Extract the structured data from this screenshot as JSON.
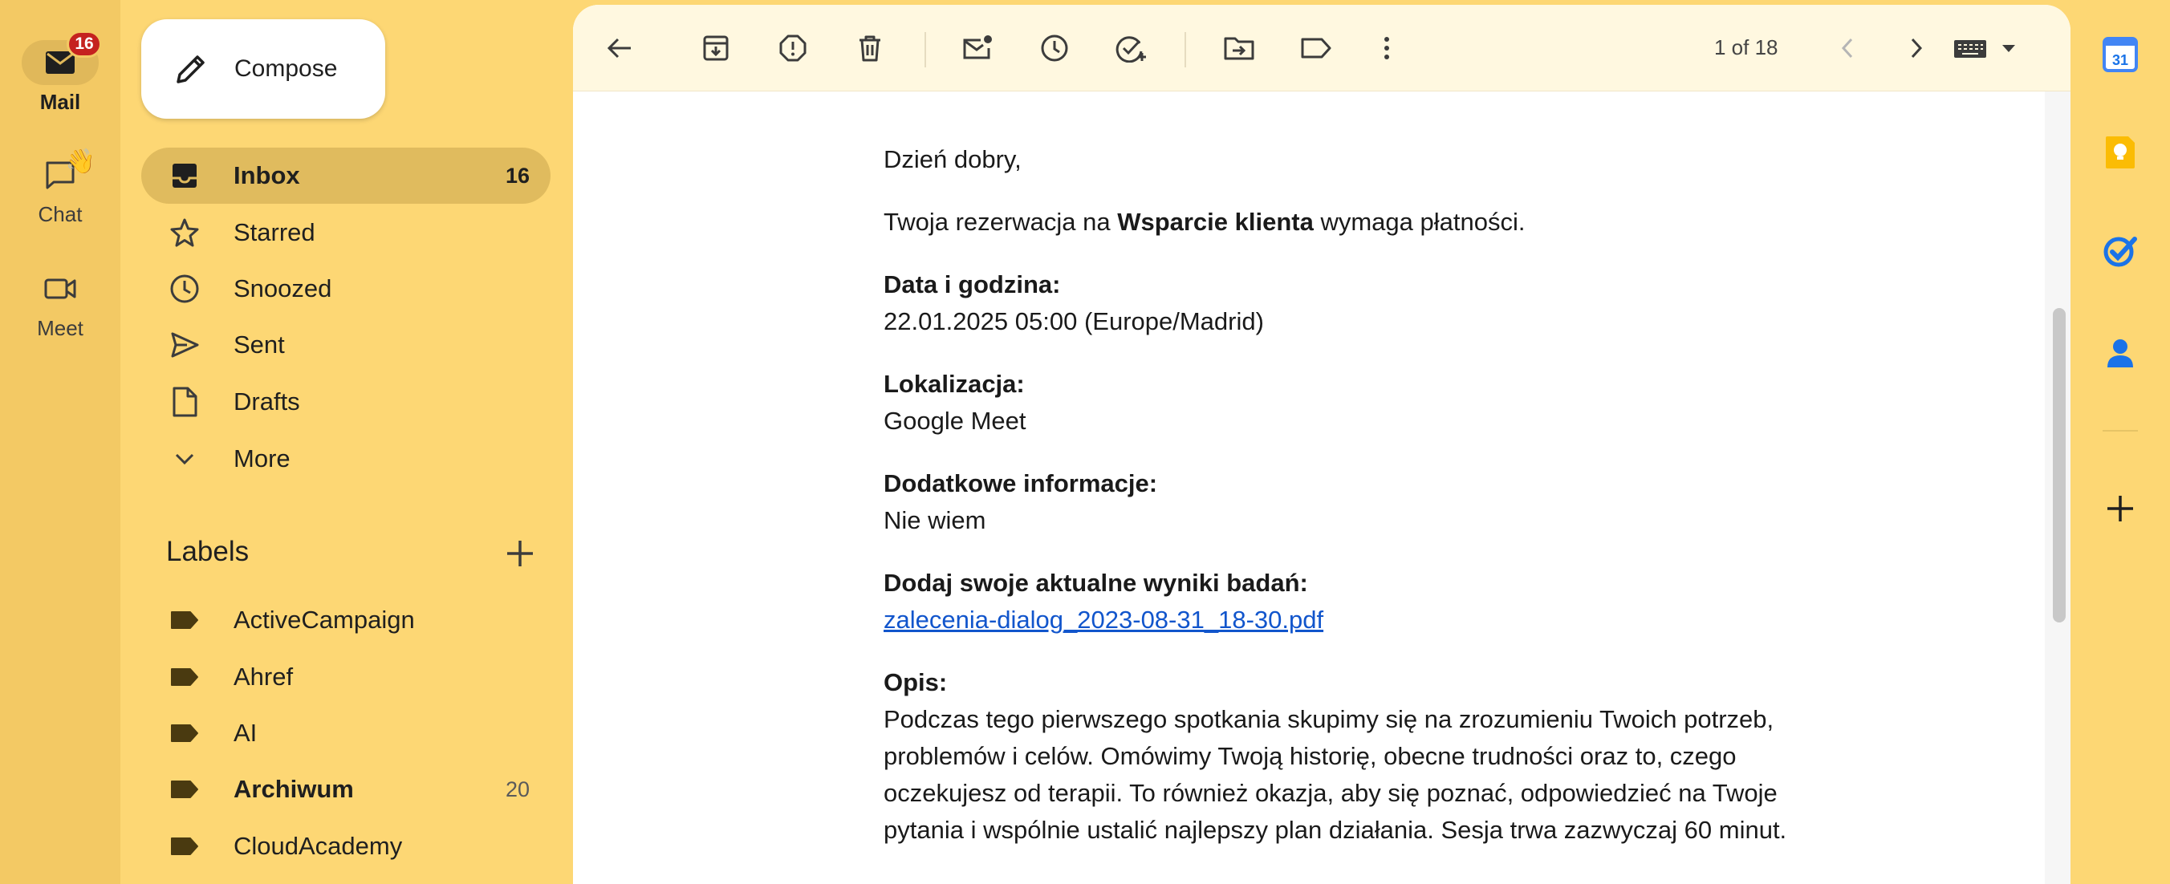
{
  "rail": {
    "mail_label": "Mail",
    "mail_badge": "16",
    "chat_label": "Chat",
    "chat_emoji": "👋",
    "meet_label": "Meet"
  },
  "nav": {
    "compose_label": "Compose",
    "items": [
      {
        "label": "Inbox",
        "count": "16",
        "icon": "inbox-icon"
      },
      {
        "label": "Starred",
        "count": "",
        "icon": "star-icon"
      },
      {
        "label": "Snoozed",
        "count": "",
        "icon": "clock-icon"
      },
      {
        "label": "Sent",
        "count": "",
        "icon": "send-icon"
      },
      {
        "label": "Drafts",
        "count": "",
        "icon": "draft-icon"
      },
      {
        "label": "More",
        "count": "",
        "icon": "chevron-down-icon"
      }
    ],
    "labels_title": "Labels",
    "labels": [
      {
        "label": "ActiveCampaign",
        "count": ""
      },
      {
        "label": "Ahref",
        "count": ""
      },
      {
        "label": "AI",
        "count": ""
      },
      {
        "label": "Archiwum",
        "count": "20"
      },
      {
        "label": "CloudAcademy",
        "count": ""
      }
    ]
  },
  "toolbar": {
    "pager": "1 of 18"
  },
  "email": {
    "greeting": "Dzień dobry,",
    "intro_before": "Twoja rezerwacja na ",
    "intro_bold": "Wsparcie klienta",
    "intro_after": " wymaga płatności.",
    "date_label": "Data i godzina:",
    "date_value": "22.01.2025 05:00 (Europe/Madrid)",
    "location_label": "Lokalizacja:",
    "location_value": "Google Meet",
    "extra_label": "Dodatkowe informacje:",
    "extra_value": "Nie wiem",
    "results_label": "Dodaj swoje aktualne wyniki badań:",
    "results_link": "zalecenia-dialog_2023-08-31_18-30.pdf",
    "desc_label": "Opis:",
    "desc_line1": "Podczas tego pierwszego spotkania skupimy się na zrozumieniu Twoich potrzeb,",
    "desc_line2": "problemów i celów. Omówimy Twoją historię, obecne trudności oraz to, czego",
    "desc_line3": "oczekujesz od terapii. To również okazja, aby się poznać, odpowiedzieć na Twoje",
    "desc_line4": "pytania i wspólnie ustalić najlepszy plan działania. Sesja trwa zazwyczaj 60 minut."
  },
  "side": {
    "calendar_day": "31"
  },
  "colors": {
    "background": "#fdd774",
    "rail": "#f3c964",
    "active_nav": "#e0bb5e",
    "badge": "#c5221f",
    "link": "#1155cc"
  }
}
